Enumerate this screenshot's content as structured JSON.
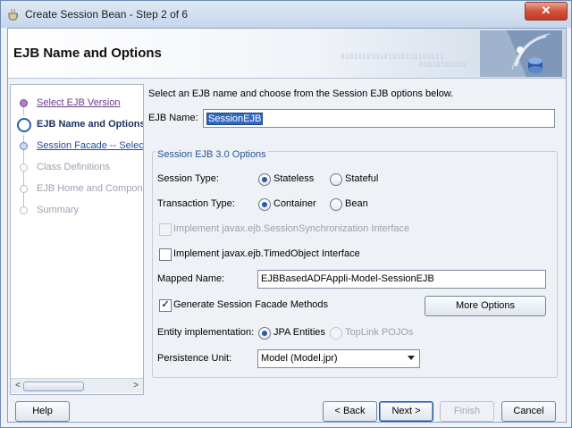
{
  "window": {
    "title": "Create Session Bean - Step 2 of 6",
    "close_glyph": "✕"
  },
  "header": {
    "title": "EJB Name and Options",
    "binary_1": "010101010101010110101011",
    "binary_2": "01010101010"
  },
  "nav": {
    "steps": [
      {
        "label": "Select EJB Version",
        "state": "visited"
      },
      {
        "label": "EJB Name and Options",
        "state": "current"
      },
      {
        "label": "Session Facade -- Select",
        "state": "link"
      },
      {
        "label": "Class Definitions",
        "state": "future"
      },
      {
        "label": "EJB Home and Component",
        "state": "future"
      },
      {
        "label": "Summary",
        "state": "future"
      }
    ],
    "scroll_left": "<",
    "scroll_right": ">"
  },
  "main": {
    "intro": "Select an EJB name and choose from the Session EJB options below.",
    "ejb_name_label": "EJB Name:",
    "ejb_name_value": "SessionEJB",
    "group_title": "Session EJB 3.0 Options",
    "session_type_label": "Session Type:",
    "session_type_options": [
      "Stateless",
      "Stateful"
    ],
    "session_type_selected": "Stateless",
    "transaction_type_label": "Transaction Type:",
    "transaction_type_options": [
      "Container",
      "Bean"
    ],
    "transaction_type_selected": "Container",
    "implement_session_sync_label": "Implement javax.ejb.SessionSynchronization Interface",
    "implement_session_sync_checked": false,
    "implement_session_sync_enabled": false,
    "implement_timed_object_label": "Implement javax.ejb.TimedObject Interface",
    "implement_timed_object_checked": false,
    "mapped_name_label": "Mapped Name:",
    "mapped_name_value": "EJBBasedADFAppli-Model-SessionEJB",
    "generate_facade_label": "Generate Session Facade Methods",
    "generate_facade_checked": true,
    "more_options_label": "More Options",
    "entity_impl_label": "Entity implementation:",
    "entity_impl_options": [
      "JPA Entities",
      "TopLink POJOs"
    ],
    "entity_impl_selected": "JPA Entities",
    "persistence_unit_label": "Persistence Unit:",
    "persistence_unit_value": "Model (Model.jpr)"
  },
  "footer": {
    "help_label": "Help",
    "back_label": "< Back",
    "next_label": "Next >",
    "finish_label": "Finish",
    "cancel_label": "Cancel"
  }
}
